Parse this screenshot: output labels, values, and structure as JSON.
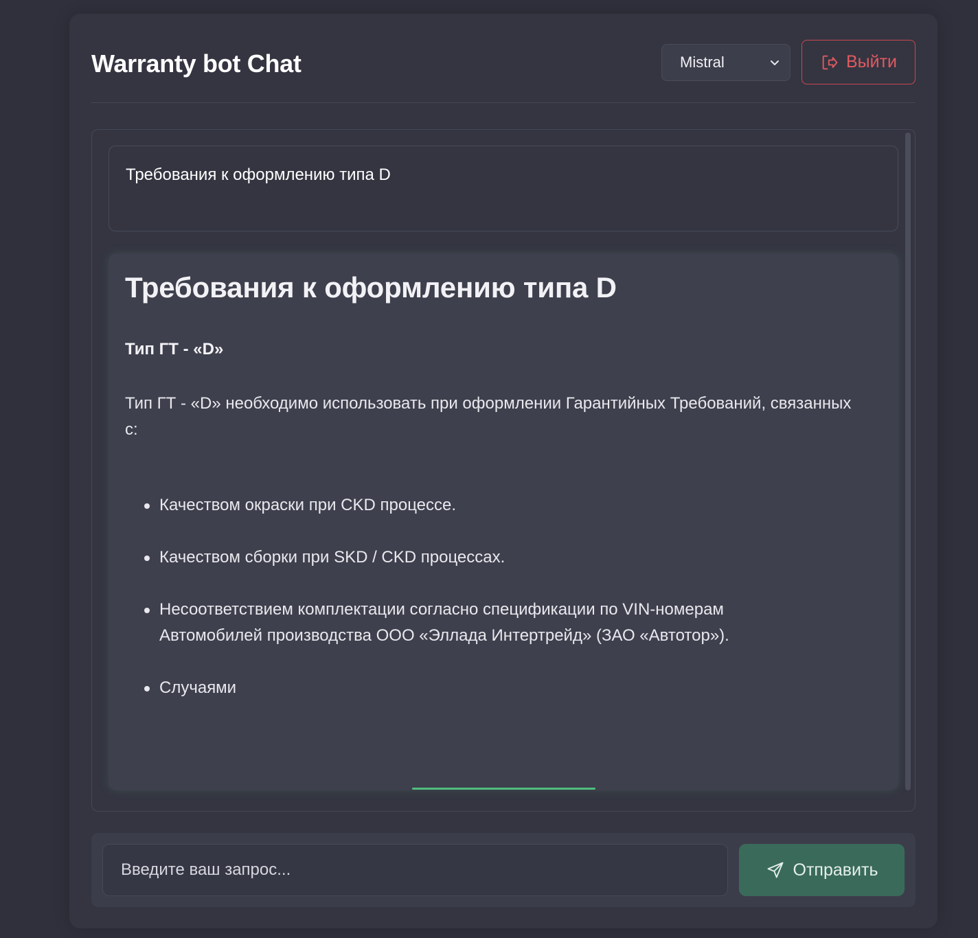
{
  "header": {
    "title": "Warranty bot Chat",
    "model_select": {
      "selected": "Mistral",
      "icon": "chevron-down-icon"
    },
    "logout_button": {
      "label": "Выйти",
      "icon": "logout-icon",
      "color": "#e05a60"
    }
  },
  "chat": {
    "user_message": "Требования к оформлению типа D",
    "bot_message": {
      "heading": "Требования к оформлению типа D",
      "subheading": "Тип ГТ - «D»",
      "paragraph": "Тип ГТ - «D» необходимо использовать при оформлении Гарантийных Требований, связанных с:",
      "items": [
        "Качеством окраски при CKD процессе.",
        "Качеством сборки при SKD / CKD процессах.",
        "Несоответствием комплектации согласно спецификации по VIN-номерам Автомобилей производства ООО «Эллада Интертрейд» (ЗАО «Автотор»).",
        "Случаями"
      ],
      "streaming_indicator_color": "#4fbf7f"
    }
  },
  "composer": {
    "placeholder": "Введите ваш запрос...",
    "send_label": "Отправить",
    "send_icon": "send-icon",
    "send_color": "#3a6b5a"
  }
}
